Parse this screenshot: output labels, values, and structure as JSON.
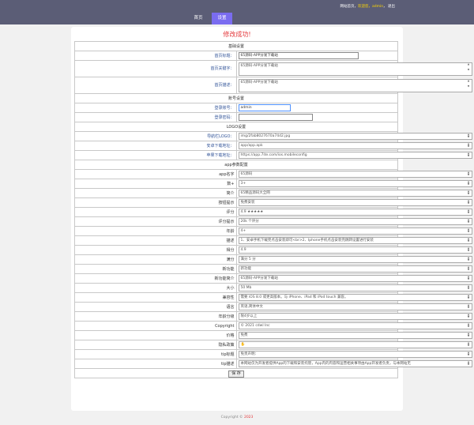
{
  "header": {
    "welcome": "网站首页，",
    "greeting": "欢迎您，",
    "username": "admin",
    "separator": "，",
    "logout": "退出",
    "nav": [
      "首页",
      "设置"
    ]
  },
  "message": "修改成功!",
  "basic": {
    "title": "基础设置",
    "home_title_label": "首页标题：",
    "home_title_value": "65源码-APP分发下载站",
    "keywords_label": "首页关键字：",
    "keywords_value": "65源码-APP分发下载站",
    "desc_label": "首页描述：",
    "desc_value": "65源码-APP分发下载站"
  },
  "account": {
    "title": "账号设置",
    "login_label": "登录账号：",
    "login_value": "admin",
    "password_label": "登录密码：",
    "password_value": ""
  },
  "logo": {
    "title": "LOGO设置",
    "rows": [
      {
        "label": "导航栏LOGO：",
        "value": "img/2fab8027670a74d2.jpg"
      },
      {
        "label": "安卓下载地址：",
        "value": "app/app.apk"
      },
      {
        "label": "苹果下载地址：",
        "value": "https://app.7ite.com/ios.mobileconfig"
      }
    ]
  },
  "app": {
    "title": "app参数配置",
    "rows": [
      {
        "label": "app名字",
        "value": "65源码"
      },
      {
        "label": "数+",
        "value": "3+"
      },
      {
        "label": "简介",
        "value": "65精品源码大全网"
      },
      {
        "label": "按钮提示",
        "value": "免费安装"
      },
      {
        "label": "评分",
        "value": "4.9 ★★★★★"
      },
      {
        "label": "评分提示",
        "value": "20k 个评分"
      },
      {
        "label": "年龄",
        "value": "4+"
      },
      {
        "label": "描述",
        "value": "1、安卓手机下载完点击安装即可<br>2、Iphone手机点击安装完跳转设置进行安装"
      },
      {
        "label": "得分",
        "value": "4.9"
      },
      {
        "label": "满分",
        "value": "满分 5 分"
      },
      {
        "label": "新功能",
        "value": "新功能"
      },
      {
        "label": "新功能简介",
        "value": "65源码-APP分发下载站"
      },
      {
        "label": "大小",
        "value": "50 Mb"
      },
      {
        "label": "兼容性",
        "value": "需要 iOS 8.0 或更高版本。与 iPhone、iPad 和 iPod touch 兼容。"
      },
      {
        "label": "语言",
        "value": "英语,简体中文"
      },
      {
        "label": "年龄分级",
        "value": "限4岁以上"
      },
      {
        "label": "Copyright",
        "value": "© 2021 cdwl Inc"
      },
      {
        "label": "价格",
        "value": "免费"
      },
      {
        "label": "隐私政策",
        "value": "✋"
      },
      {
        "label": "tip标题",
        "value": "免责声明："
      },
      {
        "label": "tip描述",
        "value": "本网站仅为开发者提供App的下载和安装托管，App内的内容和运营相关事项由App开发者负责，与本网站无"
      }
    ]
  },
  "save_label": "保 存",
  "footer": {
    "copyright": "Copyright © ",
    "year": "2023"
  }
}
